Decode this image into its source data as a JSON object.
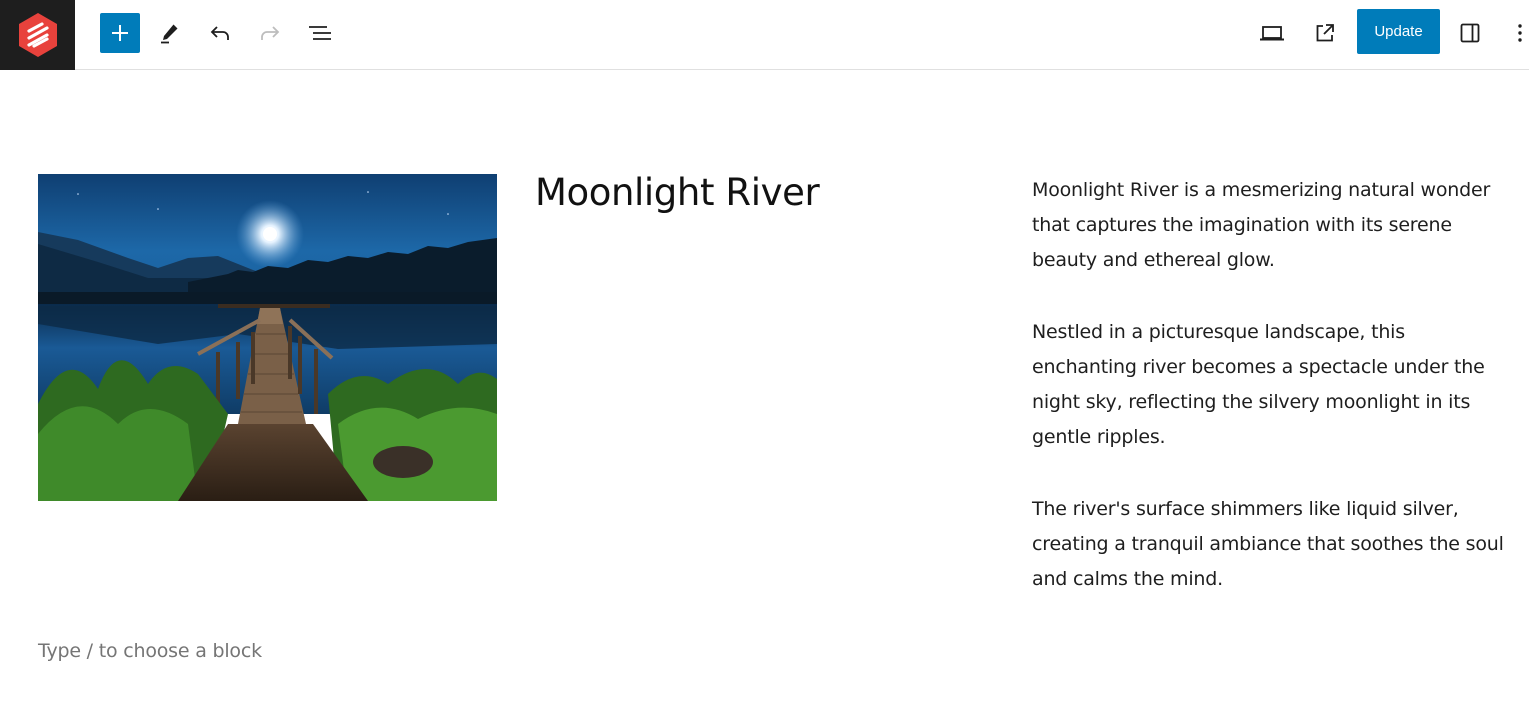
{
  "toolbar": {
    "logo_icon": "site-logo-icon",
    "add_block_icon": "plus-icon",
    "edit_icon": "pencil-icon",
    "undo_icon": "undo-icon",
    "redo_icon": "redo-icon",
    "outline_icon": "list-view-icon",
    "preview_icon": "laptop-icon",
    "view_post_icon": "external-link-icon",
    "update_label": "Update",
    "settings_icon": "sidebar-icon",
    "options_icon": "more-vertical-icon",
    "accent_color": "#007cba",
    "logo_color": "#e8423c"
  },
  "content": {
    "image_description": "",
    "title": "Moonlight River",
    "paragraphs": [
      "Moonlight River is a mesmerizing natural wonder that captures the imagination with its serene beauty and ethereal glow.",
      "Nestled in a picturesque landscape, this enchanting river becomes a spectacle under the night sky, reflecting the silvery moonlight in its gentle ripples.",
      "The river's surface shimmers like liquid silver, creating a tranquil ambiance that soothes the soul and calms the mind."
    ],
    "placeholder": "Type / to choose a block"
  }
}
